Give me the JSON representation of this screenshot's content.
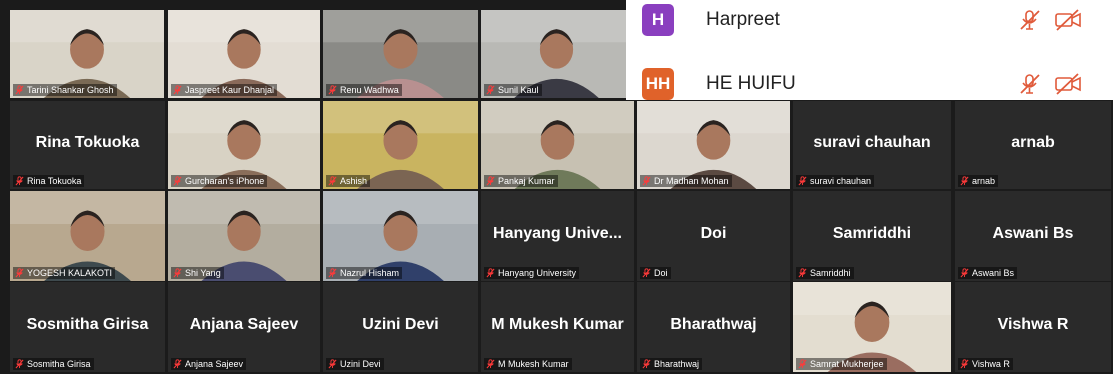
{
  "participants_panel": {
    "rows": [
      {
        "initials": "H",
        "name": "Harpreet",
        "color": "#8a3fbf"
      },
      {
        "initials": "HH",
        "name": "HE HUIFU",
        "color": "#e0622a"
      }
    ],
    "muted_icon_color": "#e05a3a"
  },
  "tiles": [
    {
      "name": "Tarini Shankar Ghosh",
      "video": true
    },
    {
      "name": "Jaspreet Kaur Dhanjal",
      "video": true
    },
    {
      "name": "Renu Wadhwa",
      "video": true,
      "highlight": true
    },
    {
      "name": "Sunil Kaul",
      "video": true
    },
    {
      "name": "Rina Tokuoka",
      "video": false
    },
    {
      "name": "Gurcharan's iPhone",
      "video": true
    },
    {
      "name": "Ashish",
      "video": true
    },
    {
      "name": "Pankaj Kumar",
      "video": true
    },
    {
      "name": "Dr Madhan Mohan",
      "video": true
    },
    {
      "name": "suravi chauhan",
      "video": false
    },
    {
      "name": "arnab",
      "video": false
    },
    {
      "name": "YOGESH KALAKOTI",
      "video": true
    },
    {
      "name": "Shi Yang",
      "video": true
    },
    {
      "name": "Nazrul Hisham",
      "video": true
    },
    {
      "name": "Hanyang University",
      "display": "Hanyang Unive...",
      "video": false
    },
    {
      "name": "Doi",
      "video": false
    },
    {
      "name": "Samriddhi",
      "video": false
    },
    {
      "name": "Aswani Bs",
      "video": false
    },
    {
      "name": "Sosmitha Girisa",
      "video": false
    },
    {
      "name": "Anjana Sajeev",
      "video": false
    },
    {
      "name": "Uzini Devi",
      "video": false
    },
    {
      "name": "M Mukesh Kumar",
      "video": false
    },
    {
      "name": "Bharathwaj",
      "video": false
    },
    {
      "name": "Samrat Mukherjee",
      "video": true
    },
    {
      "name": "Vishwa R",
      "video": false
    }
  ]
}
